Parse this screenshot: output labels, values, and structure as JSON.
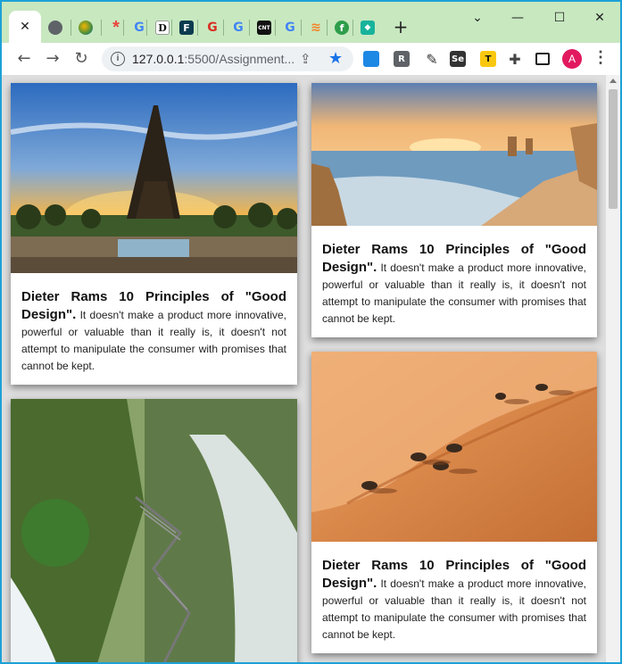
{
  "browser": {
    "tabs": [
      {
        "icon": "close-icon",
        "glyph": "✕"
      },
      {
        "icon": "globe-icon",
        "color": "#5f6368"
      },
      {
        "icon": "colorful-globe-icon",
        "color": "#4a8f3a"
      },
      {
        "icon": "asterisk-icon",
        "color": "#e8453c"
      },
      {
        "icon": "google-icon",
        "glyph": "G"
      },
      {
        "icon": "d-icon",
        "glyph": "D"
      },
      {
        "icon": "f-icon",
        "glyph": "F"
      },
      {
        "icon": "g-red-icon",
        "glyph": "G"
      },
      {
        "icon": "google-icon",
        "glyph": "G"
      },
      {
        "icon": "cnt-icon",
        "glyph": "CNT"
      },
      {
        "icon": "google-icon",
        "glyph": "G"
      },
      {
        "icon": "stack-icon",
        "glyph": "≋"
      },
      {
        "icon": "green-leaf-icon",
        "glyph": "f"
      },
      {
        "icon": "shield-icon",
        "glyph": "◆"
      }
    ],
    "new_tab": "+",
    "controls": {
      "dropdown": "⌄",
      "minimize": "—",
      "maximize": "☐",
      "close": "✕"
    },
    "url_host": "127.0.0.1",
    "url_rest": ":5500/Assignment...",
    "extensions": [
      {
        "label": "",
        "color": "#1e88e5"
      },
      {
        "label": "R",
        "color": "#5f6368"
      },
      {
        "label": "",
        "color": "#333"
      },
      {
        "label": "Se",
        "color": "#333"
      },
      {
        "label": "T",
        "color": "#f9c80e"
      },
      {
        "label": "",
        "color": "#444"
      },
      {
        "label": "",
        "color": "#222"
      }
    ],
    "avatar": "A",
    "colors": {
      "tabstrip": "#c8e8c0",
      "accent": "#1a73e8",
      "window_border": "#1da1d6"
    }
  },
  "cards": [
    {
      "image": "eiffel-tower-sunset",
      "title": "Dieter Rams 10 Principles of \"Good Design\".",
      "body": "It doesn't make a product more innovative, powerful or valuable than it really is, it doesn't not attempt to manipulate the consumer with promises that cannot be kept."
    },
    {
      "image": "coastal-cliffs-sunset",
      "title": "Dieter Rams 10 Principles of \"Good Design\".",
      "body": "It doesn't make a product more innovative, powerful or valuable than it really is, it doesn't not attempt to manipulate the consumer with promises that cannot be kept."
    },
    {
      "image": "waterfall-staircase",
      "title": "",
      "body": ""
    },
    {
      "image": "desert-oryx-dunes",
      "title": "Dieter Rams 10 Principles of \"Good Design\".",
      "body": "It doesn't make a product more innovative, powerful or valuable than it really is, it doesn't not attempt to manipulate the consumer with promises that cannot be kept."
    }
  ]
}
